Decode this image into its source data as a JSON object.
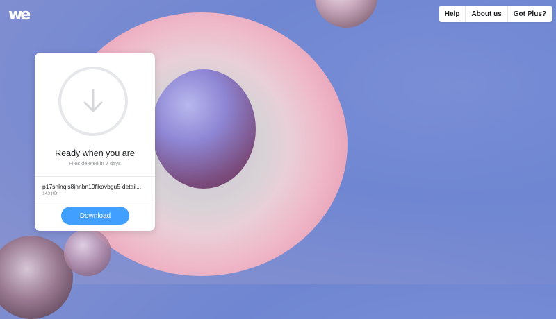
{
  "brand": {
    "logo_text": "we"
  },
  "nav": {
    "items": [
      {
        "label": "Help"
      },
      {
        "label": "About us"
      },
      {
        "label": "Got Plus?"
      }
    ]
  },
  "card": {
    "icon": "download-arrow-icon",
    "title": "Ready when you are",
    "subtitle": "Files deleted in 7 days",
    "file": {
      "name": "p17snlnqis8jnnbn19fikavbgu5-detail...",
      "size": "143 KB"
    },
    "download_label": "Download"
  },
  "colors": {
    "accent": "#409fff",
    "background": "#7b8fd6",
    "ring": "#e89fb6"
  }
}
